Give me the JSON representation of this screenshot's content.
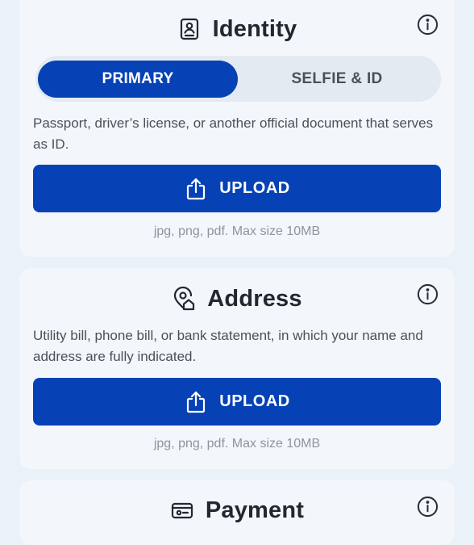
{
  "identity": {
    "title": "Identity",
    "title_icon": "id-document-icon",
    "tabs": [
      {
        "label": "PRIMARY",
        "active": true
      },
      {
        "label": "SELFIE & ID",
        "active": false
      }
    ],
    "description": "Passport, driver’s license, or another official document that serves as ID.",
    "upload_label": "UPLOAD",
    "hint": "jpg, png, pdf. Max size 10MB"
  },
  "address": {
    "title": "Address",
    "title_icon": "location-home-icon",
    "description": "Utility bill, phone bill, or bank statement, in which your name and address are fully indicated.",
    "upload_label": "UPLOAD",
    "hint": "jpg, png, pdf. Max size 10MB"
  },
  "payment": {
    "title": "Payment",
    "title_icon": "payment-card-icon"
  },
  "colors": {
    "primary": "#0642b5",
    "background": "#eaf1f9",
    "card": "#f3f7fc",
    "tab_track": "#e3eaf2",
    "hint_text": "#8f949b"
  }
}
